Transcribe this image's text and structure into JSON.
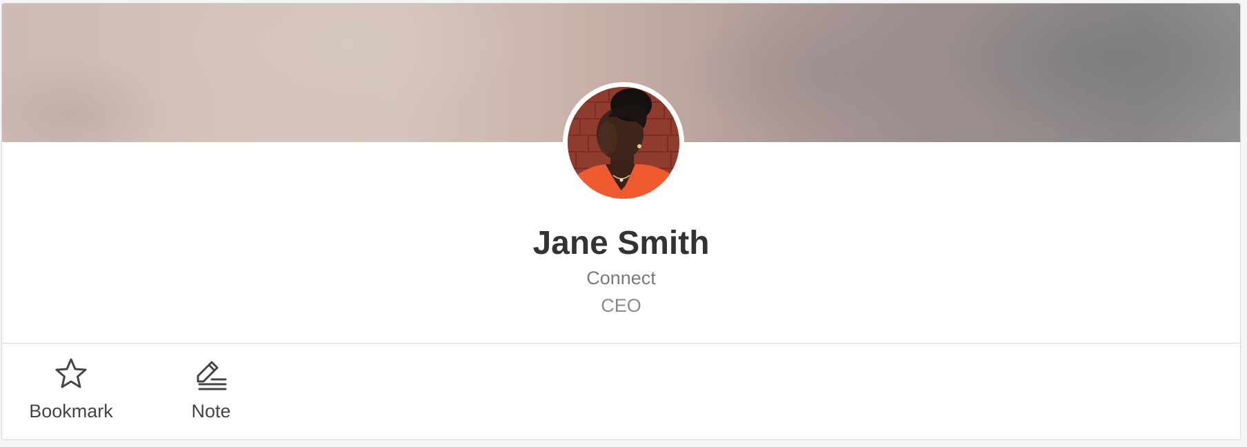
{
  "profile": {
    "name": "Jane Smith",
    "connect_label": "Connect",
    "role": "CEO"
  },
  "actions": {
    "bookmark_label": "Bookmark",
    "note_label": "Note"
  },
  "icons": {
    "bookmark": "star-icon",
    "note": "edit-note-icon"
  },
  "colors": {
    "name_text": "#333333",
    "secondary_text": "#7a7a7a",
    "action_text": "#444444",
    "divider": "#d9d9d9"
  }
}
